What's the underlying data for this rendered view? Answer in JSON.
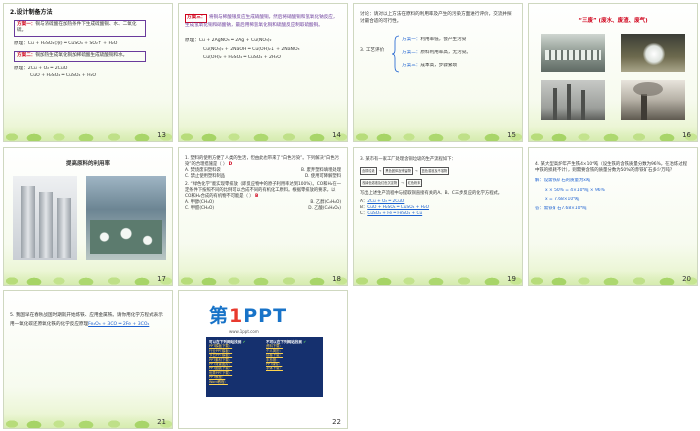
{
  "slides": [
    {
      "num": "13",
      "title": "2.设计制备方法",
      "plan1_label": "方案一：",
      "plan1_text": "铜与浓硫酸在加热条件下生成硫酸铜、水、二氧化硫。",
      "plan1_eq": "原理：Cu + H₂SO₄(浓) ═ CuSO₄ + SO₂↑ + H₂O",
      "plan2_label": "方案二：",
      "plan2_text": "铜加热生成氧化铜加稀硫酸生成硫酸铜和水。",
      "plan2_eq1": "原理：2Cu + O₂ ═ 2CuO",
      "plan2_eq2": "CuO + H₂SO₄ ═ CuSO₄ + H₂O"
    },
    {
      "num": "14",
      "plan3_label": "方案三：",
      "plan3_text": "将铜与稀酸银反应生成硝酸铜，然后将硝酸铜和氢氧化钠反应，生成氢氧化铜和硝酸钠，最后用稀氢氧化铜和硫酸反应制取硫酸铜。",
      "eq1": "原理：Cu + 2AgNO₃ ═ 2Ag + Cu(NO₃)₂",
      "eq2": "Cu(NO₃)₂ + 2NaOH ═ Cu(OH)₂↓ + 2NaNO₃",
      "eq3": "Cu(OH)₂ + H₂SO₄ ═ CuSO₄ + 2H₂O"
    },
    {
      "num": "15",
      "intro": "讨论：请对以上方法在原料的利用率及产生的污染方面进行评价，交流并探讨最合适的可行性。",
      "heading": "3. 工艺评价",
      "item1_label": "方案一：",
      "item1_text": "利用率低，会产生污染",
      "item2_label": "方案二：",
      "item2_text": "原料利用率高，无污染。",
      "item3_label": "方案三：",
      "item3_text": "成本高，步骤繁琐"
    },
    {
      "num": "16",
      "title": "“三废” (废水、废渣、废气)"
    },
    {
      "num": "17",
      "title": "提高原料的利用率"
    },
    {
      "num": "18",
      "q1": "1. 塑料的使用方便了人类的生活，但由此也带来了“白色污染”。下列解决“白色污染”的合理措施是（    ）",
      "q1_answer": "D",
      "q1_a": "A. 焚烧废旧塑料袋",
      "q1_b": "B. 废弃塑料填埋处理",
      "q1_c": "C. 禁止使用塑料制品",
      "q1_d": "D. 使用可降解塑料",
      "q2": "2. “绿色化学”能实现零排放（即反应物中的原子利用率达到100%）。CO和H₂在一定条件下按照不同的比例可以合成不同的有机化工原料。根据零排放的要求，以CO和H₂合成的有机物不可能是（    ）",
      "q2_answer": "B",
      "q2_a": "A. 甲醇(CH₄O)",
      "q2_b": "B. 乙醇(C₂H₆O)",
      "q2_c": "C. 甲醛(CH₂O)",
      "q2_d": "D. 乙酸(C₂H₄O₂)"
    },
    {
      "num": "19",
      "q": "3. 某市有一家工厂处理含铜垃圾的生产流程如下：",
      "flow": [
        "含铜垃圾",
        "黑色固体及残留物",
        "蓝色溶液及不溶物",
        "浅绿色溶液及红色沉淀物",
        "红色粉末"
      ],
      "ask": "写出上述生产流程中与提取铜直接有关的A、B、C三步反应的化学方程式。",
      "a_label": "A",
      "a_eq": "2Cu + O₂ ═ 2CuO",
      "b_label": "B",
      "b_eq": "CuO + H₂SO₄ ═ CuSO₄ + H₂O",
      "c_label": "C",
      "c_eq": "CuSO₄ + Fe ═ FeSO₄ + Cu"
    },
    {
      "num": "20",
      "q": "4. 某大型高炉年产生铁4×10⁴吨（设生铁的含铁质量分数为96%，在冶炼过程中铁的损耗不计），则需要含铁的质量分数为50%的赤铁矿石多少万吨？",
      "s1": "解：设需铁矿石的质量为x吨",
      "s2": "x    ×  50%  =  4×10⁴吨 × 96%",
      "s3": "x  =  7.68×10⁴吨",
      "s4": "答：需铁矿石7.68×10⁴吨"
    },
    {
      "num": "21",
      "q": "5. 我国早在春秋战国时期就开始炼铁、应用金属铁。请你用化学方程式表示用一氧化碳还原氧化铁的化学反应原理",
      "answer": "Fe₂O₃ + 3CO ═ 2Fe + 3CO₂"
    },
    {
      "num": "22",
      "logo_a": "第",
      "logo_b": "1",
      "logo_c": "PPT",
      "sub": "www.1ppt.com",
      "left_head": "可以在下列网站找到",
      "right_head": "不可以在下列网站找到",
      "left_links": [
        "PPT模板下载：",
        "行业PPT模板：",
        "节日PPT模板：",
        "PPT素材下载：",
        "PPT背景图片：",
        "PPT图表下载：",
        "优秀PPT下载：",
        "PPT教程：",
        "Word教程："
      ],
      "right_links": [
        "资料下载：",
        "个人简历：",
        "试卷下载：",
        "手抄报：",
        "PPT课件：",
        "字体下载："
      ]
    }
  ]
}
